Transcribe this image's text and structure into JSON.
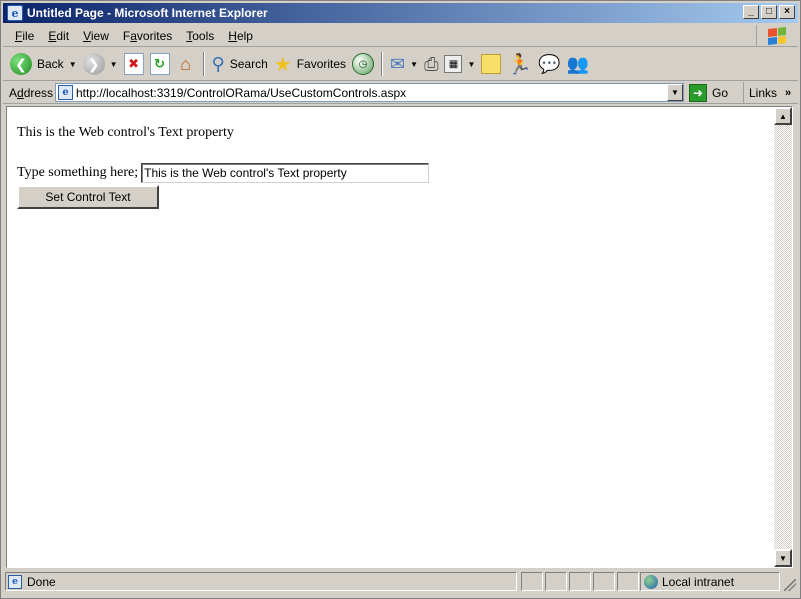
{
  "window": {
    "title": "Untitled Page - Microsoft Internet Explorer",
    "controls": {
      "minimize": "_",
      "maximize": "□",
      "close": "×"
    }
  },
  "menu": [
    {
      "label": "File",
      "u": "F",
      "rest": "ile"
    },
    {
      "label": "Edit",
      "u": "E",
      "rest": "dit"
    },
    {
      "label": "View",
      "u": "V",
      "rest": "iew"
    },
    {
      "label": "Favorites",
      "u": "a",
      "pre": "F",
      "rest": "vorites"
    },
    {
      "label": "Tools",
      "u": "T",
      "rest": "ools"
    },
    {
      "label": "Help",
      "u": "H",
      "rest": "elp"
    }
  ],
  "toolbar": {
    "back_label": "Back",
    "search_label": "Search",
    "favorites_label": "Favorites"
  },
  "address": {
    "label_u": "d",
    "label_pre": "A",
    "label_rest": "dress",
    "url": "http://localhost:3319/ControlORama/UseCustomControls.aspx",
    "go_label": "Go",
    "links_label": "Links"
  },
  "page": {
    "text_property": "This is the Web control's Text property",
    "type_label": "Type something here;",
    "input_value": "This is the Web control's Text property",
    "button_label": "Set Control Text"
  },
  "status": {
    "text": "Done",
    "zone": "Local intranet"
  }
}
